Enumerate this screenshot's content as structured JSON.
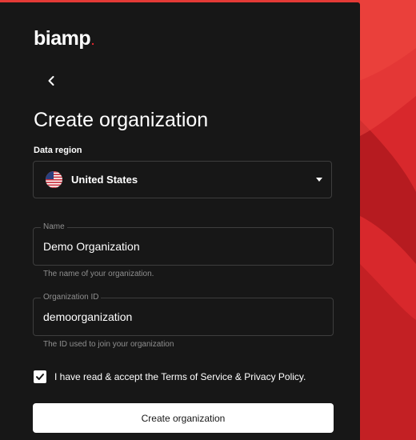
{
  "brand": {
    "logo_text": "biamp",
    "logo_dot": ".",
    "accent_color": "#e8262d",
    "background_color": "#d8282c",
    "panel_color": "#171717"
  },
  "nav": {
    "back_icon": "chevron-left-icon"
  },
  "page": {
    "title": "Create organization"
  },
  "data_region": {
    "label": "Data region",
    "selected": "United States",
    "flag_icon": "us-flag-icon",
    "dropdown_icon": "caret-down-icon"
  },
  "name_field": {
    "label": "Name",
    "value": "Demo Organization",
    "helper": "The name of your organization."
  },
  "org_id_field": {
    "label": "Organization ID",
    "value": "demoorganization",
    "helper": "The ID used to join your organization"
  },
  "terms": {
    "checked": true,
    "label": "I have read & accept the Terms of Service & Privacy Policy."
  },
  "submit": {
    "label": "Create organization"
  }
}
